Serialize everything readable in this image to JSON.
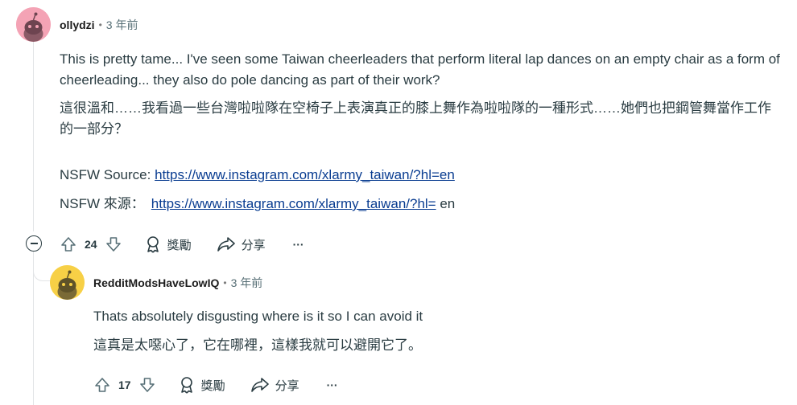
{
  "comment": {
    "username": "ollydzi",
    "time": "3 年前",
    "paragraphs": [
      "This is pretty tame... I've seen some Taiwan cheerleaders that perform literal lap dances on an empty chair as a form of cheerleading... they also do pole dancing as part of their work?",
      "這很溫和……我看過一些台灣啦啦隊在空椅子上表演真正的膝上舞作為啦啦隊的一種形式……她們也把鋼管舞當作工作的一部分？"
    ],
    "source_label": "NSFW Source: ",
    "source_link": "https://www.instagram.com/xlarmy_taiwan/?hl=en",
    "source_label_zh": "NSFW 來源：",
    "source_link_zh": "https://www.instagram.com/xlarmy_taiwan/?hl=",
    "source_suffix_zh": " en",
    "votes": "24",
    "award_label": "獎勵",
    "share_label": "分享",
    "more_label": "···"
  },
  "reply": {
    "username": "RedditModsHaveLowIQ",
    "time": "3 年前",
    "paragraphs": [
      "Thats absolutely disgusting where is it so I can avoid it",
      "這真是太噁心了，它在哪裡，這樣我就可以避開它了。"
    ],
    "votes": "17",
    "award_label": "獎勵",
    "share_label": "分享",
    "more_label": "···"
  },
  "colors": {
    "avatar1_bg": "#f4a3b5",
    "avatar2_bg": "#f7d046",
    "link": "#0a3d91",
    "thread_line": "#e2e4e6"
  },
  "icons": [
    "snoo-avatar-icon",
    "upvote-icon",
    "downvote-icon",
    "award-icon",
    "share-icon",
    "collapse-icon"
  ]
}
